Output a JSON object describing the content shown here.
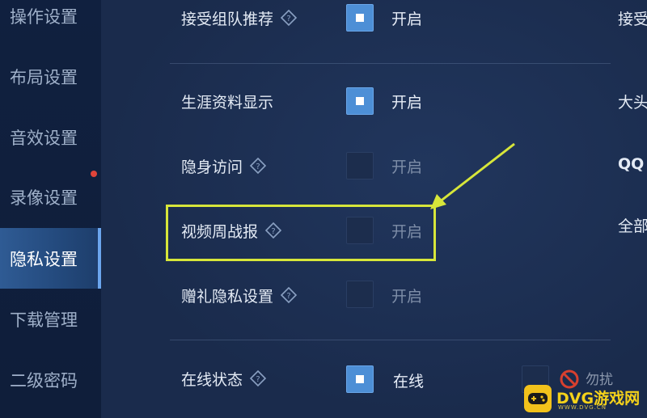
{
  "sidebar": {
    "items": [
      {
        "label": "操作设置",
        "active": false
      },
      {
        "label": "布局设置",
        "active": false
      },
      {
        "label": "音效设置",
        "active": false
      },
      {
        "label": "录像设置",
        "active": false,
        "badge": true
      },
      {
        "label": "隐私设置",
        "active": true
      },
      {
        "label": "下载管理",
        "active": false
      },
      {
        "label": "二级密码",
        "active": false
      }
    ]
  },
  "settings": {
    "rows": [
      {
        "label": "接受组队推荐",
        "has_help": true,
        "checked": true,
        "option": "开启"
      },
      {
        "label": "生涯资料显示",
        "has_help": false,
        "checked": true,
        "option": "开启"
      },
      {
        "label": "隐身访问",
        "has_help": true,
        "checked": false,
        "option": "开启"
      },
      {
        "label": "视频周战报",
        "has_help": true,
        "checked": false,
        "option": "开启"
      },
      {
        "label": "赠礼隐私设置",
        "has_help": true,
        "checked": false,
        "option": "开启"
      },
      {
        "label": "在线状态",
        "has_help": true,
        "checked": true,
        "option": "在线"
      }
    ],
    "right_column": [
      "接受",
      "大头",
      "QQ",
      "全部"
    ],
    "busy_option": "勿扰"
  },
  "annotation": {
    "highlight_color": "#d7e63a"
  },
  "watermark": {
    "brand": "DVG游戏网",
    "sub": "WWW.DVG.CN"
  },
  "colors": {
    "accent": "#4d8fd6",
    "background": "#1b2c4d",
    "sidebar_active": "#2f5b94"
  }
}
